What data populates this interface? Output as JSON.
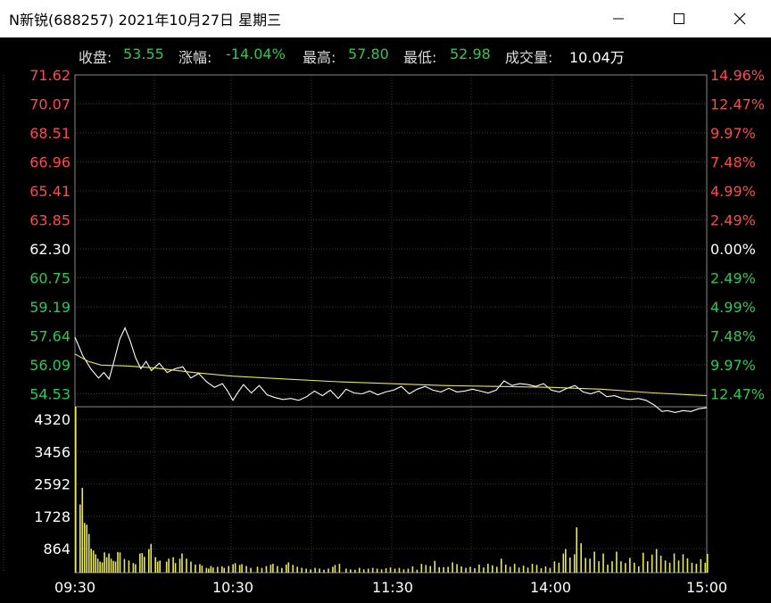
{
  "window": {
    "title": "N新锐(688257)  2021年10月27日  星期三",
    "controls": [
      "minimize-icon",
      "maximize-icon",
      "close-icon"
    ]
  },
  "info": {
    "close_label": "收盘:",
    "close_value": "53.55",
    "change_label": "涨幅:",
    "change_value": "-14.04%",
    "high_label": "最高:",
    "high_value": "57.80",
    "low_label": "最低:",
    "low_value": "52.98",
    "volume_label": "成交量:",
    "volume_value": "10.04万"
  },
  "colors": {
    "up": "#ff4a4a",
    "down": "#2ec856",
    "neutral": "#ffffff",
    "price_line": "#ffffff",
    "avg_line": "#e8e85a",
    "volume_bar": "#e8e85a",
    "grid": "#3a3a3a",
    "axis": "#888888"
  },
  "chart_data": [
    {
      "type": "line",
      "subtype": "intraday-time-sharing",
      "ylim": [
        53.755,
        71.62
      ],
      "y_ticks_left": [
        "71.62",
        "70.07",
        "68.51",
        "66.96",
        "65.41",
        "63.85",
        "62.30",
        "60.75",
        "59.19",
        "57.64",
        "56.09",
        "54.53"
      ],
      "y_ticks_right": [
        "14.96%",
        "12.47%",
        "9.97%",
        "7.48%",
        "4.99%",
        "2.49%",
        "0.00%",
        "2.49%",
        "4.99%",
        "7.48%",
        "9.97%",
        "12.47%"
      ],
      "reference_price": 62.3,
      "x_minutes_range": [
        0,
        240
      ],
      "series": [
        {
          "role": "price",
          "points": [
            [
              0,
              57.5
            ],
            [
              3,
              56.5
            ],
            [
              6,
              55.8
            ],
            [
              9,
              55.3
            ],
            [
              11,
              55.6
            ],
            [
              13,
              55.25
            ],
            [
              15,
              56.3
            ],
            [
              17,
              57.4
            ],
            [
              19,
              58.0
            ],
            [
              21,
              57.3
            ],
            [
              23,
              56.4
            ],
            [
              25,
              55.8
            ],
            [
              27,
              56.2
            ],
            [
              29,
              55.7
            ],
            [
              32,
              56.1
            ],
            [
              35,
              55.6
            ],
            [
              38,
              55.8
            ],
            [
              41,
              55.9
            ],
            [
              44,
              55.3
            ],
            [
              47,
              55.55
            ],
            [
              50,
              55.1
            ],
            [
              53,
              54.8
            ],
            [
              56,
              55.0
            ],
            [
              58,
              54.6
            ],
            [
              60,
              54.1
            ],
            [
              62,
              54.55
            ],
            [
              64,
              54.95
            ],
            [
              67,
              54.5
            ],
            [
              70,
              54.9
            ],
            [
              73,
              54.4
            ],
            [
              76,
              54.25
            ],
            [
              79,
              54.15
            ],
            [
              82,
              54.2
            ],
            [
              85,
              54.1
            ],
            [
              88,
              54.3
            ],
            [
              91,
              54.6
            ],
            [
              94,
              54.35
            ],
            [
              97,
              54.65
            ],
            [
              100,
              54.2
            ],
            [
              103,
              54.7
            ],
            [
              106,
              54.5
            ],
            [
              109,
              54.45
            ],
            [
              112,
              54.6
            ],
            [
              115,
              54.4
            ],
            [
              118,
              54.55
            ],
            [
              121,
              54.65
            ],
            [
              124,
              54.85
            ],
            [
              127,
              54.45
            ],
            [
              130,
              54.7
            ],
            [
              133,
              54.85
            ],
            [
              136,
              54.65
            ],
            [
              139,
              54.55
            ],
            [
              142,
              54.75
            ],
            [
              145,
              54.55
            ],
            [
              148,
              54.6
            ],
            [
              151,
              54.7
            ],
            [
              154,
              54.6
            ],
            [
              157,
              54.5
            ],
            [
              160,
              54.65
            ],
            [
              163,
              55.15
            ],
            [
              166,
              54.9
            ],
            [
              169,
              55.0
            ],
            [
              172,
              54.95
            ],
            [
              175,
              54.85
            ],
            [
              178,
              55.0
            ],
            [
              181,
              54.65
            ],
            [
              184,
              54.55
            ],
            [
              187,
              54.75
            ],
            [
              190,
              54.9
            ],
            [
              193,
              54.55
            ],
            [
              196,
              54.45
            ],
            [
              199,
              54.6
            ],
            [
              202,
              54.3
            ],
            [
              205,
              54.35
            ],
            [
              208,
              54.2
            ],
            [
              211,
              54.15
            ],
            [
              214,
              54.2
            ],
            [
              217,
              54.1
            ],
            [
              220,
              53.85
            ],
            [
              223,
              53.5
            ],
            [
              225,
              53.55
            ],
            [
              228,
              53.45
            ],
            [
              231,
              53.55
            ],
            [
              234,
              53.5
            ],
            [
              237,
              53.65
            ],
            [
              240,
              53.7
            ]
          ]
        },
        {
          "role": "average",
          "points": [
            [
              0,
              56.6
            ],
            [
              5,
              56.2
            ],
            [
              10,
              56.0
            ],
            [
              20,
              55.95
            ],
            [
              30,
              55.85
            ],
            [
              45,
              55.6
            ],
            [
              60,
              55.4
            ],
            [
              80,
              55.25
            ],
            [
              100,
              55.1
            ],
            [
              120,
              55.0
            ],
            [
              140,
              54.9
            ],
            [
              160,
              54.85
            ],
            [
              180,
              54.8
            ],
            [
              200,
              54.7
            ],
            [
              220,
              54.5
            ],
            [
              240,
              54.35
            ]
          ]
        }
      ]
    },
    {
      "type": "bar",
      "subtype": "volume",
      "ylim": [
        0,
        4500
      ],
      "y_ticks": [
        "4320",
        "3456",
        "2592",
        "1728",
        "864"
      ],
      "x_tick_labels": [
        "09:30",
        "10:30",
        "11:30",
        "14:00",
        "15:00"
      ],
      "bars": [
        [
          0,
          4500
        ],
        [
          2,
          1850
        ],
        [
          3,
          2300
        ],
        [
          4,
          1350
        ],
        [
          5,
          1300
        ],
        [
          6,
          1050
        ],
        [
          7,
          650
        ],
        [
          8,
          600
        ],
        [
          9,
          500
        ],
        [
          10,
          380
        ],
        [
          11,
          300
        ],
        [
          12,
          280
        ],
        [
          13,
          550
        ],
        [
          14,
          420
        ],
        [
          15,
          520
        ],
        [
          16,
          380
        ],
        [
          17,
          320
        ],
        [
          18,
          300
        ],
        [
          19,
          560
        ],
        [
          20,
          550
        ],
        [
          22,
          370
        ],
        [
          24,
          330
        ],
        [
          26,
          260
        ],
        [
          27,
          230
        ],
        [
          29,
          520
        ],
        [
          30,
          530
        ],
        [
          31,
          430
        ],
        [
          33,
          640
        ],
        [
          34,
          780
        ],
        [
          36,
          420
        ],
        [
          37,
          300
        ],
        [
          38,
          330
        ],
        [
          41,
          300
        ],
        [
          42,
          380
        ],
        [
          44,
          420
        ],
        [
          45,
          260
        ],
        [
          47,
          380
        ],
        [
          48,
          520
        ],
        [
          50,
          380
        ],
        [
          52,
          300
        ],
        [
          54,
          220
        ],
        [
          56,
          230
        ],
        [
          57,
          190
        ],
        [
          59,
          130
        ],
        [
          60,
          110
        ],
        [
          61,
          180
        ],
        [
          62,
          140
        ],
        [
          64,
          160
        ],
        [
          66,
          170
        ],
        [
          67,
          130
        ],
        [
          69,
          180
        ],
        [
          71,
          230
        ],
        [
          72,
          260
        ],
        [
          74,
          210
        ],
        [
          75,
          230
        ],
        [
          77,
          180
        ],
        [
          79,
          130
        ],
        [
          82,
          160
        ],
        [
          84,
          130
        ],
        [
          86,
          180
        ],
        [
          88,
          220
        ],
        [
          89,
          240
        ],
        [
          91,
          180
        ],
        [
          93,
          130
        ],
        [
          95,
          220
        ],
        [
          96,
          280
        ],
        [
          98,
          210
        ],
        [
          100,
          160
        ],
        [
          102,
          130
        ],
        [
          104,
          110
        ],
        [
          106,
          90
        ],
        [
          108,
          130
        ],
        [
          110,
          110
        ],
        [
          112,
          80
        ],
        [
          114,
          110
        ],
        [
          116,
          160
        ],
        [
          117,
          210
        ],
        [
          119,
          240
        ],
        [
          122,
          110
        ],
        [
          124,
          90
        ],
        [
          126,
          80
        ],
        [
          128,
          130
        ],
        [
          130,
          90
        ],
        [
          132,
          110
        ],
        [
          134,
          130
        ],
        [
          136,
          110
        ],
        [
          138,
          90
        ],
        [
          140,
          120
        ],
        [
          142,
          140
        ],
        [
          144,
          110
        ],
        [
          146,
          130
        ],
        [
          148,
          90
        ],
        [
          150,
          110
        ],
        [
          152,
          170
        ],
        [
          154,
          80
        ],
        [
          156,
          240
        ],
        [
          158,
          210
        ],
        [
          160,
          180
        ],
        [
          162,
          320
        ],
        [
          164,
          150
        ],
        [
          166,
          150
        ],
        [
          168,
          160
        ],
        [
          170,
          280
        ],
        [
          172,
          230
        ],
        [
          174,
          170
        ],
        [
          176,
          130
        ],
        [
          178,
          160
        ],
        [
          180,
          120
        ],
        [
          182,
          220
        ],
        [
          184,
          140
        ],
        [
          186,
          240
        ],
        [
          188,
          200
        ],
        [
          190,
          160
        ],
        [
          192,
          380
        ],
        [
          194,
          220
        ],
        [
          196,
          160
        ],
        [
          198,
          240
        ],
        [
          200,
          140
        ],
        [
          202,
          190
        ],
        [
          204,
          140
        ],
        [
          206,
          240
        ],
        [
          208,
          210
        ],
        [
          210,
          120
        ],
        [
          212,
          170
        ],
        [
          214,
          130
        ],
        [
          216,
          310
        ],
        [
          218,
          270
        ],
        [
          220,
          520
        ],
        [
          221,
          640
        ],
        [
          223,
          410
        ],
        [
          225,
          500
        ],
        [
          226,
          1230
        ],
        [
          228,
          800
        ],
        [
          230,
          400
        ],
        [
          232,
          380
        ],
        [
          234,
          570
        ],
        [
          236,
          310
        ],
        [
          238,
          520
        ],
        [
          240,
          220
        ],
        [
          242,
          310
        ],
        [
          244,
          570
        ],
        [
          246,
          310
        ],
        [
          248,
          260
        ],
        [
          250,
          400
        ],
        [
          252,
          270
        ],
        [
          254,
          170
        ],
        [
          256,
          540
        ],
        [
          258,
          310
        ],
        [
          260,
          490
        ],
        [
          262,
          640
        ],
        [
          264,
          460
        ],
        [
          266,
          330
        ],
        [
          268,
          270
        ],
        [
          270,
          520
        ],
        [
          272,
          330
        ],
        [
          274,
          500
        ],
        [
          276,
          390
        ],
        [
          278,
          270
        ],
        [
          280,
          240
        ],
        [
          282,
          370
        ],
        [
          284,
          270
        ],
        [
          285,
          510
        ]
      ]
    }
  ]
}
